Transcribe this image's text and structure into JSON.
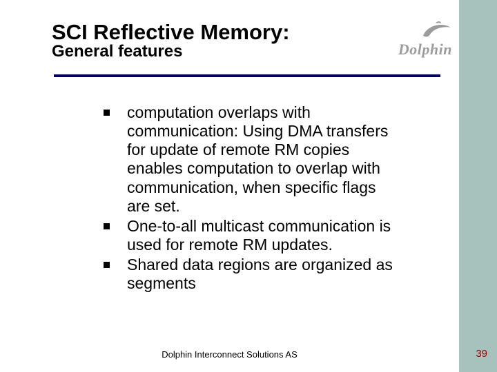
{
  "header": {
    "title": "SCI Reflective Memory:",
    "subtitle": "General features"
  },
  "logo": {
    "text": "Dolphin",
    "icon_name": "dolphin-icon",
    "color": "#9c9c9c"
  },
  "bullets": [
    "computation overlaps with communication: Using DMA transfers for update of remote RM copies enables computation to overlap with communication, when specific flags are set.",
    "One-to-all multicast communication is used for remote RM updates.",
    "Shared data regions are organized as segments"
  ],
  "footer": {
    "text": "Dolphin Interconnect Solutions AS",
    "page_number": "39"
  },
  "colors": {
    "rule": "#000063",
    "sidebar": "#a7c1bd",
    "page_number": "#9a0000"
  }
}
